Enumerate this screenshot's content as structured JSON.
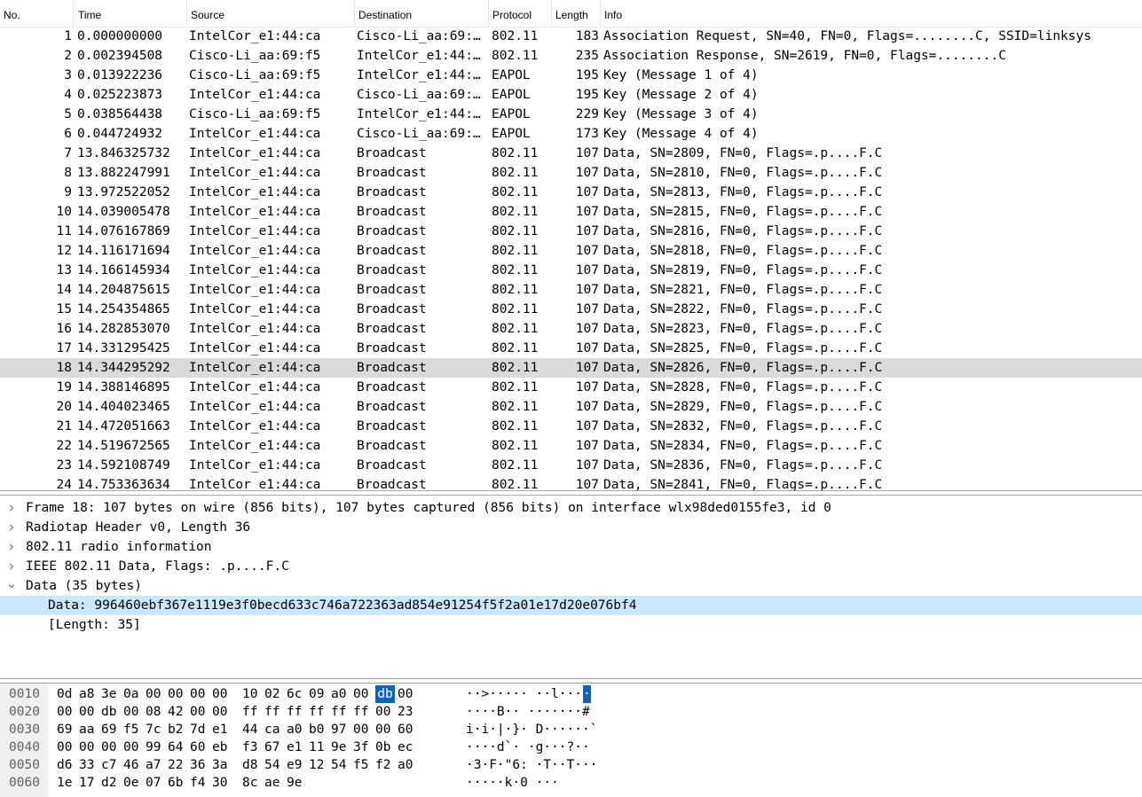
{
  "packet_list": {
    "columns": {
      "no": "No.",
      "time": "Time",
      "source": "Source",
      "destination": "Destination",
      "protocol": "Protocol",
      "length": "Length",
      "info": "Info"
    },
    "selected_no": "18",
    "rows": [
      {
        "no": "1",
        "time": "0.000000000",
        "source": "IntelCor_e1:44:ca",
        "destination": "Cisco-Li_aa:69:…",
        "protocol": "802.11",
        "length": "183",
        "info": "Association Request, SN=40, FN=0, Flags=........C, SSID=linksys"
      },
      {
        "no": "2",
        "time": "0.002394508",
        "source": "Cisco-Li_aa:69:f5",
        "destination": "IntelCor_e1:44:…",
        "protocol": "802.11",
        "length": "235",
        "info": "Association Response, SN=2619, FN=0, Flags=........C"
      },
      {
        "no": "3",
        "time": "0.013922236",
        "source": "Cisco-Li_aa:69:f5",
        "destination": "IntelCor_e1:44:…",
        "protocol": "EAPOL",
        "length": "195",
        "info": "Key (Message 1 of 4)"
      },
      {
        "no": "4",
        "time": "0.025223873",
        "source": "IntelCor_e1:44:ca",
        "destination": "Cisco-Li_aa:69:…",
        "protocol": "EAPOL",
        "length": "195",
        "info": "Key (Message 2 of 4)"
      },
      {
        "no": "5",
        "time": "0.038564438",
        "source": "Cisco-Li_aa:69:f5",
        "destination": "IntelCor_e1:44:…",
        "protocol": "EAPOL",
        "length": "229",
        "info": "Key (Message 3 of 4)"
      },
      {
        "no": "6",
        "time": "0.044724932",
        "source": "IntelCor_e1:44:ca",
        "destination": "Cisco-Li_aa:69:…",
        "protocol": "EAPOL",
        "length": "173",
        "info": "Key (Message 4 of 4)"
      },
      {
        "no": "7",
        "time": "13.846325732",
        "source": "IntelCor_e1:44:ca",
        "destination": "Broadcast",
        "protocol": "802.11",
        "length": "107",
        "info": "Data, SN=2809, FN=0, Flags=.p....F.C"
      },
      {
        "no": "8",
        "time": "13.882247991",
        "source": "IntelCor_e1:44:ca",
        "destination": "Broadcast",
        "protocol": "802.11",
        "length": "107",
        "info": "Data, SN=2810, FN=0, Flags=.p....F.C"
      },
      {
        "no": "9",
        "time": "13.972522052",
        "source": "IntelCor_e1:44:ca",
        "destination": "Broadcast",
        "protocol": "802.11",
        "length": "107",
        "info": "Data, SN=2813, FN=0, Flags=.p....F.C"
      },
      {
        "no": "10",
        "time": "14.039005478",
        "source": "IntelCor_e1:44:ca",
        "destination": "Broadcast",
        "protocol": "802.11",
        "length": "107",
        "info": "Data, SN=2815, FN=0, Flags=.p....F.C"
      },
      {
        "no": "11",
        "time": "14.076167869",
        "source": "IntelCor_e1:44:ca",
        "destination": "Broadcast",
        "protocol": "802.11",
        "length": "107",
        "info": "Data, SN=2816, FN=0, Flags=.p....F.C"
      },
      {
        "no": "12",
        "time": "14.116171694",
        "source": "IntelCor_e1:44:ca",
        "destination": "Broadcast",
        "protocol": "802.11",
        "length": "107",
        "info": "Data, SN=2818, FN=0, Flags=.p....F.C"
      },
      {
        "no": "13",
        "time": "14.166145934",
        "source": "IntelCor_e1:44:ca",
        "destination": "Broadcast",
        "protocol": "802.11",
        "length": "107",
        "info": "Data, SN=2819, FN=0, Flags=.p....F.C"
      },
      {
        "no": "14",
        "time": "14.204875615",
        "source": "IntelCor_e1:44:ca",
        "destination": "Broadcast",
        "protocol": "802.11",
        "length": "107",
        "info": "Data, SN=2821, FN=0, Flags=.p....F.C"
      },
      {
        "no": "15",
        "time": "14.254354865",
        "source": "IntelCor_e1:44:ca",
        "destination": "Broadcast",
        "protocol": "802.11",
        "length": "107",
        "info": "Data, SN=2822, FN=0, Flags=.p....F.C"
      },
      {
        "no": "16",
        "time": "14.282853070",
        "source": "IntelCor_e1:44:ca",
        "destination": "Broadcast",
        "protocol": "802.11",
        "length": "107",
        "info": "Data, SN=2823, FN=0, Flags=.p....F.C"
      },
      {
        "no": "17",
        "time": "14.331295425",
        "source": "IntelCor_e1:44:ca",
        "destination": "Broadcast",
        "protocol": "802.11",
        "length": "107",
        "info": "Data, SN=2825, FN=0, Flags=.p....F.C"
      },
      {
        "no": "18",
        "time": "14.344295292",
        "source": "IntelCor_e1:44:ca",
        "destination": "Broadcast",
        "protocol": "802.11",
        "length": "107",
        "info": "Data, SN=2826, FN=0, Flags=.p....F.C"
      },
      {
        "no": "19",
        "time": "14.388146895",
        "source": "IntelCor_e1:44:ca",
        "destination": "Broadcast",
        "protocol": "802.11",
        "length": "107",
        "info": "Data, SN=2828, FN=0, Flags=.p....F.C"
      },
      {
        "no": "20",
        "time": "14.404023465",
        "source": "IntelCor_e1:44:ca",
        "destination": "Broadcast",
        "protocol": "802.11",
        "length": "107",
        "info": "Data, SN=2829, FN=0, Flags=.p....F.C"
      },
      {
        "no": "21",
        "time": "14.472051663",
        "source": "IntelCor_e1:44:ca",
        "destination": "Broadcast",
        "protocol": "802.11",
        "length": "107",
        "info": "Data, SN=2832, FN=0, Flags=.p....F.C"
      },
      {
        "no": "22",
        "time": "14.519672565",
        "source": "IntelCor_e1:44:ca",
        "destination": "Broadcast",
        "protocol": "802.11",
        "length": "107",
        "info": "Data, SN=2834, FN=0, Flags=.p....F.C"
      },
      {
        "no": "23",
        "time": "14.592108749",
        "source": "IntelCor_e1:44:ca",
        "destination": "Broadcast",
        "protocol": "802.11",
        "length": "107",
        "info": "Data, SN=2836, FN=0, Flags=.p....F.C"
      },
      {
        "no": "24",
        "time": "14.753363634",
        "source": "IntelCor_e1:44:ca",
        "destination": "Broadcast",
        "protocol": "802.11",
        "length": "107",
        "info": "Data, SN=2841, FN=0, Flags=.p....F.C"
      }
    ]
  },
  "details": {
    "rows": [
      {
        "text": "Frame 18: 107 bytes on wire (856 bits), 107 bytes captured (856 bits) on interface wlx98ded0155fe3, id 0",
        "state": "collapsed",
        "icon": "chevron-right-icon"
      },
      {
        "text": "Radiotap Header v0, Length 36",
        "state": "collapsed",
        "icon": "chevron-right-icon"
      },
      {
        "text": "802.11 radio information",
        "state": "collapsed",
        "icon": "chevron-right-icon"
      },
      {
        "text": "IEEE 802.11 Data, Flags: .p....F.C",
        "state": "collapsed",
        "icon": "chevron-right-icon"
      },
      {
        "text": "Data (35 bytes)",
        "state": "expanded",
        "icon": "chevron-down-icon"
      },
      {
        "text": "Data: 996460ebf367e1119e3f0becd633c746a722363ad854e91254f5f2a01e17d20e076bf4",
        "state": "selected-child"
      },
      {
        "text": "[Length: 35]",
        "state": "child"
      }
    ]
  },
  "bytes": {
    "rows": [
      {
        "offset": "0010",
        "hex": [
          "0d",
          "a8",
          "3e",
          "0a",
          "00",
          "00",
          "00",
          "00",
          "10",
          "02",
          "6c",
          "09",
          "a0",
          "00",
          "db",
          "00"
        ],
        "ascii": "··>····· ··l···",
        "ascii_sel": "·",
        "sel_index": 14
      },
      {
        "offset": "0020",
        "hex": [
          "00",
          "00",
          "db",
          "00",
          "08",
          "42",
          "00",
          "00",
          "ff",
          "ff",
          "ff",
          "ff",
          "ff",
          "ff",
          "00",
          "23"
        ],
        "ascii": "····B·· ·······#"
      },
      {
        "offset": "0030",
        "hex": [
          "69",
          "aa",
          "69",
          "f5",
          "7c",
          "b2",
          "7d",
          "e1",
          "44",
          "ca",
          "a0",
          "b0",
          "97",
          "00",
          "00",
          "60"
        ],
        "ascii": "i·i·|·}· D······`"
      },
      {
        "offset": "0040",
        "hex": [
          "00",
          "00",
          "00",
          "00",
          "99",
          "64",
          "60",
          "eb",
          "f3",
          "67",
          "e1",
          "11",
          "9e",
          "3f",
          "0b",
          "ec"
        ],
        "ascii": "····d`· ·g···?··"
      },
      {
        "offset": "0050",
        "hex": [
          "d6",
          "33",
          "c7",
          "46",
          "a7",
          "22",
          "36",
          "3a",
          "d8",
          "54",
          "e9",
          "12",
          "54",
          "f5",
          "f2",
          "a0"
        ],
        "ascii": "·3·F·\"6: ·T··T···"
      },
      {
        "offset": "0060",
        "hex": [
          "1e",
          "17",
          "d2",
          "0e",
          "07",
          "6b",
          "f4",
          "30",
          "8c",
          "ae",
          "9e"
        ],
        "ascii": "·····k·0 ···"
      }
    ]
  },
  "colors": {
    "selected_row": "#dadada",
    "selected_detail": "#cce8ff",
    "selected_byte": "#0a64c8"
  }
}
